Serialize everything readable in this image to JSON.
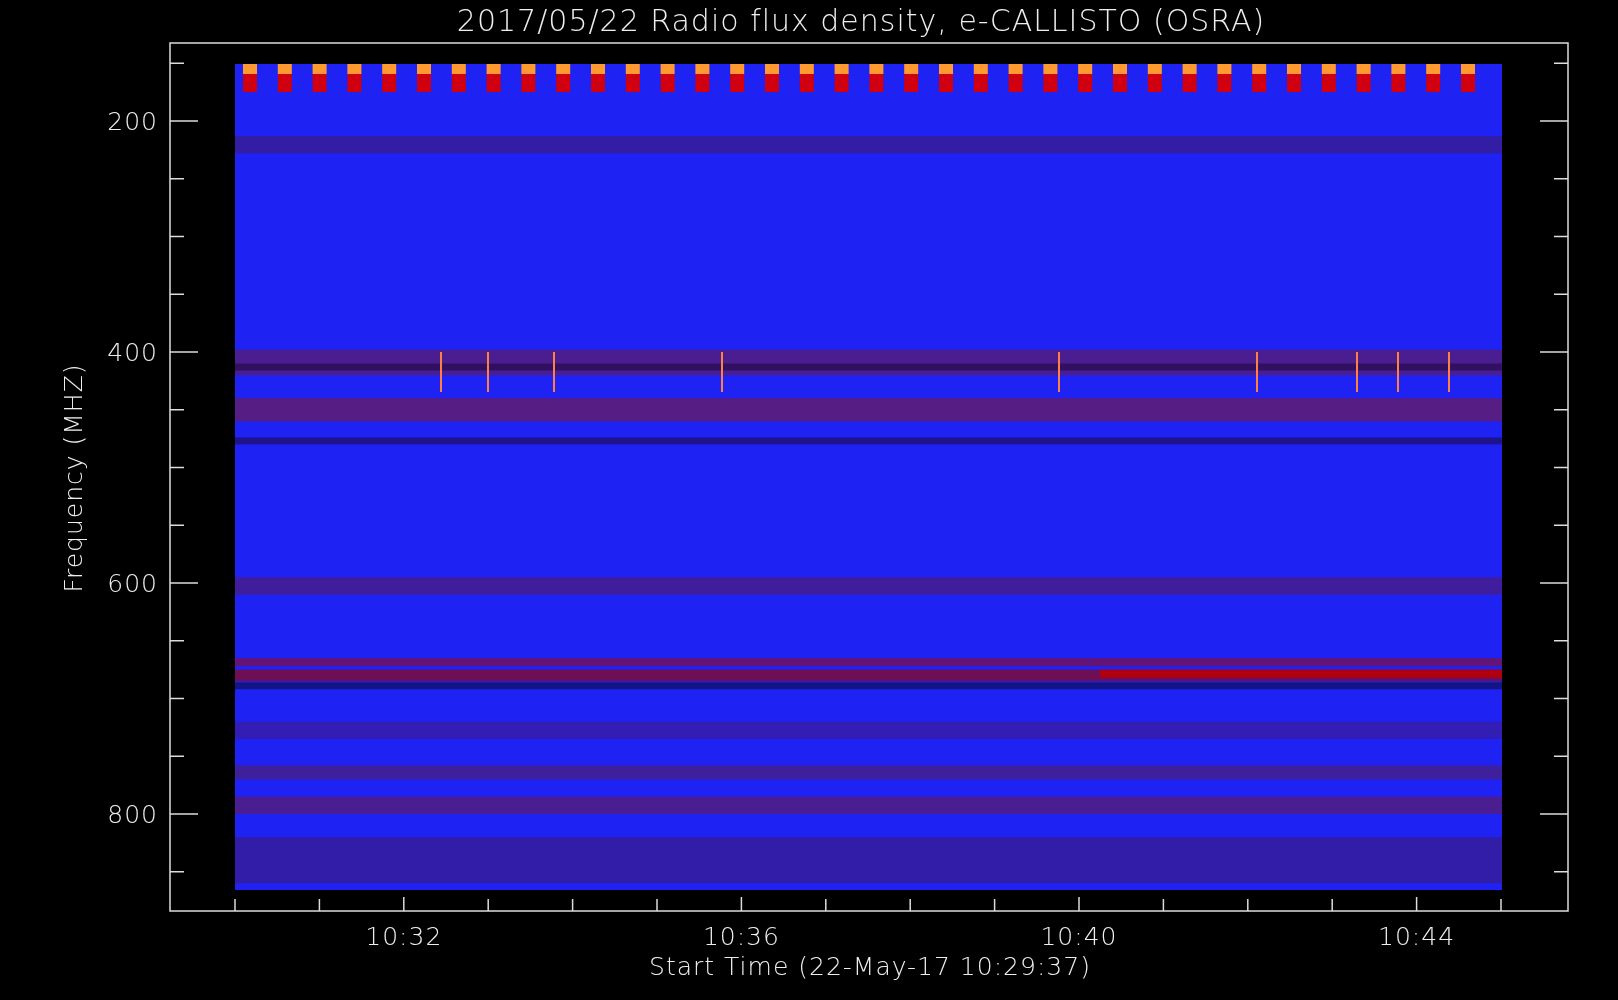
{
  "title": "2017/05/22  Radio flux density, e-CALLISTO (OSRA)",
  "y_axis": {
    "label": "Frequency (MHZ)",
    "ticks": [
      "200",
      "400",
      "600",
      "800"
    ]
  },
  "x_axis": {
    "label": "Start Time (22-May-17 10:29:37)",
    "ticks": [
      "10:32",
      "10:36",
      "10:40",
      "10:44"
    ]
  }
}
